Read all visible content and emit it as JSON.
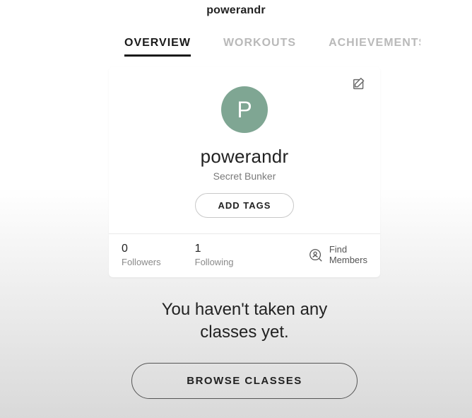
{
  "header": {
    "title": "powerandr"
  },
  "tabs": [
    {
      "label": "OVERVIEW",
      "active": true
    },
    {
      "label": "WORKOUTS",
      "active": false
    },
    {
      "label": "ACHIEVEMENTS",
      "active": false
    }
  ],
  "profile": {
    "avatar_initial": "P",
    "username": "powerandr",
    "location": "Secret Bunker",
    "add_tags_label": "ADD TAGS"
  },
  "stats": {
    "followers": {
      "count": "0",
      "label": "Followers"
    },
    "following": {
      "count": "1",
      "label": "Following"
    },
    "find_members_label_line1": "Find",
    "find_members_label_line2": "Members"
  },
  "empty_state": {
    "message_line1": "You haven't taken any",
    "message_line2": "classes yet.",
    "browse_label": "BROWSE CLASSES"
  }
}
